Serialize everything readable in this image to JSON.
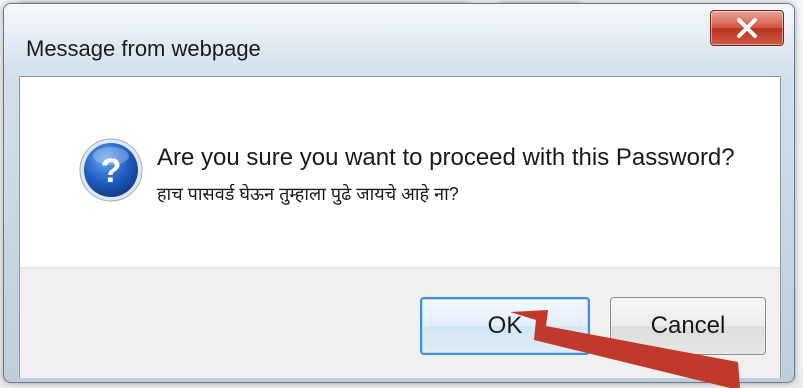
{
  "dialog": {
    "title": "Message from webpage",
    "message_line1": "Are you sure you want to proceed with this Password?",
    "message_line2": "हाच पासवर्ड घेऊन तुम्हाला पुढे जायचे आहे ना?",
    "ok_label": "OK",
    "cancel_label": "Cancel",
    "icon": "question-icon",
    "close_icon": "close-icon"
  },
  "colors": {
    "close_button": "#c9452f",
    "default_button_border": "#3d8ee0",
    "annotation_arrow": "#c0392b"
  }
}
